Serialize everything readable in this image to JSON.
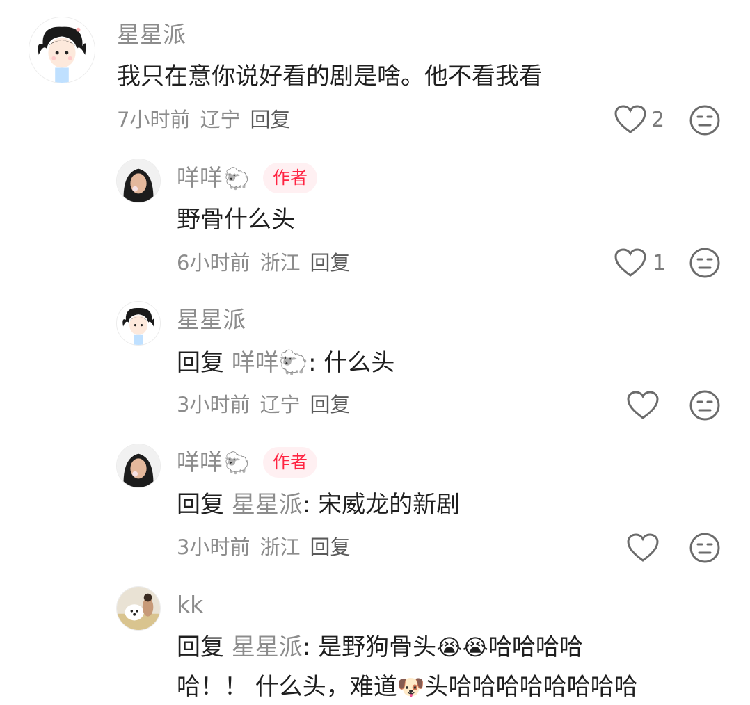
{
  "comments": [
    {
      "user": "星星派",
      "text": "我只在意你说好看的剧是啥。他不看我看",
      "time": "7小时前",
      "location": "辽宁",
      "reply_label": "回复",
      "likes": "2"
    },
    {
      "user": "咩咩",
      "user_emoji": "🐑",
      "badge": "作者",
      "text": "野骨什么头",
      "time": "6小时前",
      "location": "浙江",
      "reply_label": "回复",
      "likes": "1"
    },
    {
      "user": "星星派",
      "text_prefix": "回复",
      "reply_to": "咩咩🐑",
      "text": ": 什么头",
      "time": "3小时前",
      "location": "辽宁",
      "reply_label": "回复",
      "likes": ""
    },
    {
      "user": "咩咩",
      "user_emoji": "🐑",
      "badge": "作者",
      "text_prefix": "回复",
      "reply_to": "星星派",
      "text": ": 宋威龙的新剧",
      "time": "3小时前",
      "location": "浙江",
      "reply_label": "回复",
      "likes": ""
    },
    {
      "user": "kk",
      "text_prefix": "回复",
      "reply_to": "星星派",
      "text_line1": ": 是野狗骨头",
      "emoji_a": "😭",
      "emoji_b": "😭",
      "text_line1_end": "哈哈哈哈",
      "text_line2_start": "哈！！ 什么头，难道",
      "emoji_dog": "🐶",
      "text_line2_end": "头哈哈哈哈哈哈哈哈"
    }
  ],
  "colors": {
    "author_badge_bg": "#fff0f2",
    "author_badge_text": "#ff2442",
    "muted_text": "#8c8c8c"
  },
  "icons": {
    "like": "heart-outline-icon",
    "dislike": "meh-face-icon"
  }
}
